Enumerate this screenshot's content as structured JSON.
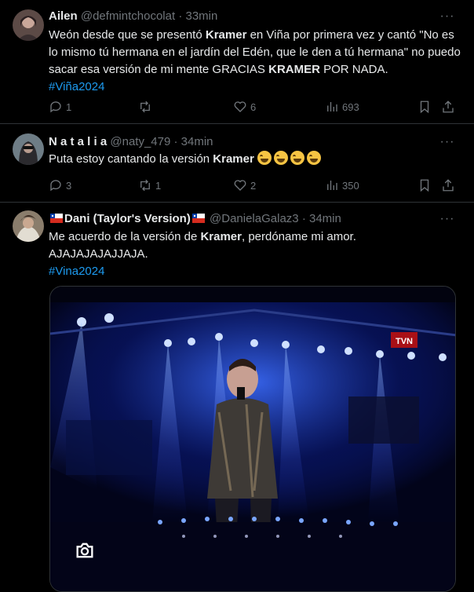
{
  "tweets": [
    {
      "name": "Ailen",
      "handle": "@defmintchocolat",
      "time": "33min",
      "segments": [
        {
          "t": "Weón desde que se presentó ",
          "b": false
        },
        {
          "t": "Kramer",
          "b": true
        },
        {
          "t": " en Viña por primera vez y cantó \"No es lo mismo tú hermana en el jardín del Edén, que le den a tú hermana\" no puedo sacar esa versión de mi mente GRACIAS ",
          "b": false
        },
        {
          "t": "KRAMER",
          "b": true
        },
        {
          "t": " POR NADA.",
          "b": false
        }
      ],
      "hashtag": "#Viña2024",
      "replies": "1",
      "retweets": "",
      "likes": "6",
      "views": "693"
    },
    {
      "name": "N a t a l i a",
      "handle": "@naty_479",
      "time": "34min",
      "segments": [
        {
          "t": "Puta estoy cantando la versión ",
          "b": false
        },
        {
          "t": "Kramer",
          "b": true
        }
      ],
      "emoji_count": 4,
      "replies": "3",
      "retweets": "1",
      "likes": "2",
      "views": "350"
    },
    {
      "name": "Dani (Taylor's Version)",
      "handle": "@DanielaGalaz3",
      "time": "34min",
      "segments": [
        {
          "t": "Me acuerdo de la versión de ",
          "b": false
        },
        {
          "t": "Kramer",
          "b": true
        },
        {
          "t": ", perdóname mi amor.",
          "b": false
        }
      ],
      "line2": "AJAJAJAJAJJAJA.",
      "hashtag": "#Vina2024"
    }
  ],
  "separator": "·",
  "more_label": "···",
  "media_logo_text": "TVN",
  "colors": {
    "background": "#000000",
    "text": "#e7e9ea",
    "muted": "#71767b",
    "link": "#1d9bf0",
    "border": "#2f3336"
  }
}
